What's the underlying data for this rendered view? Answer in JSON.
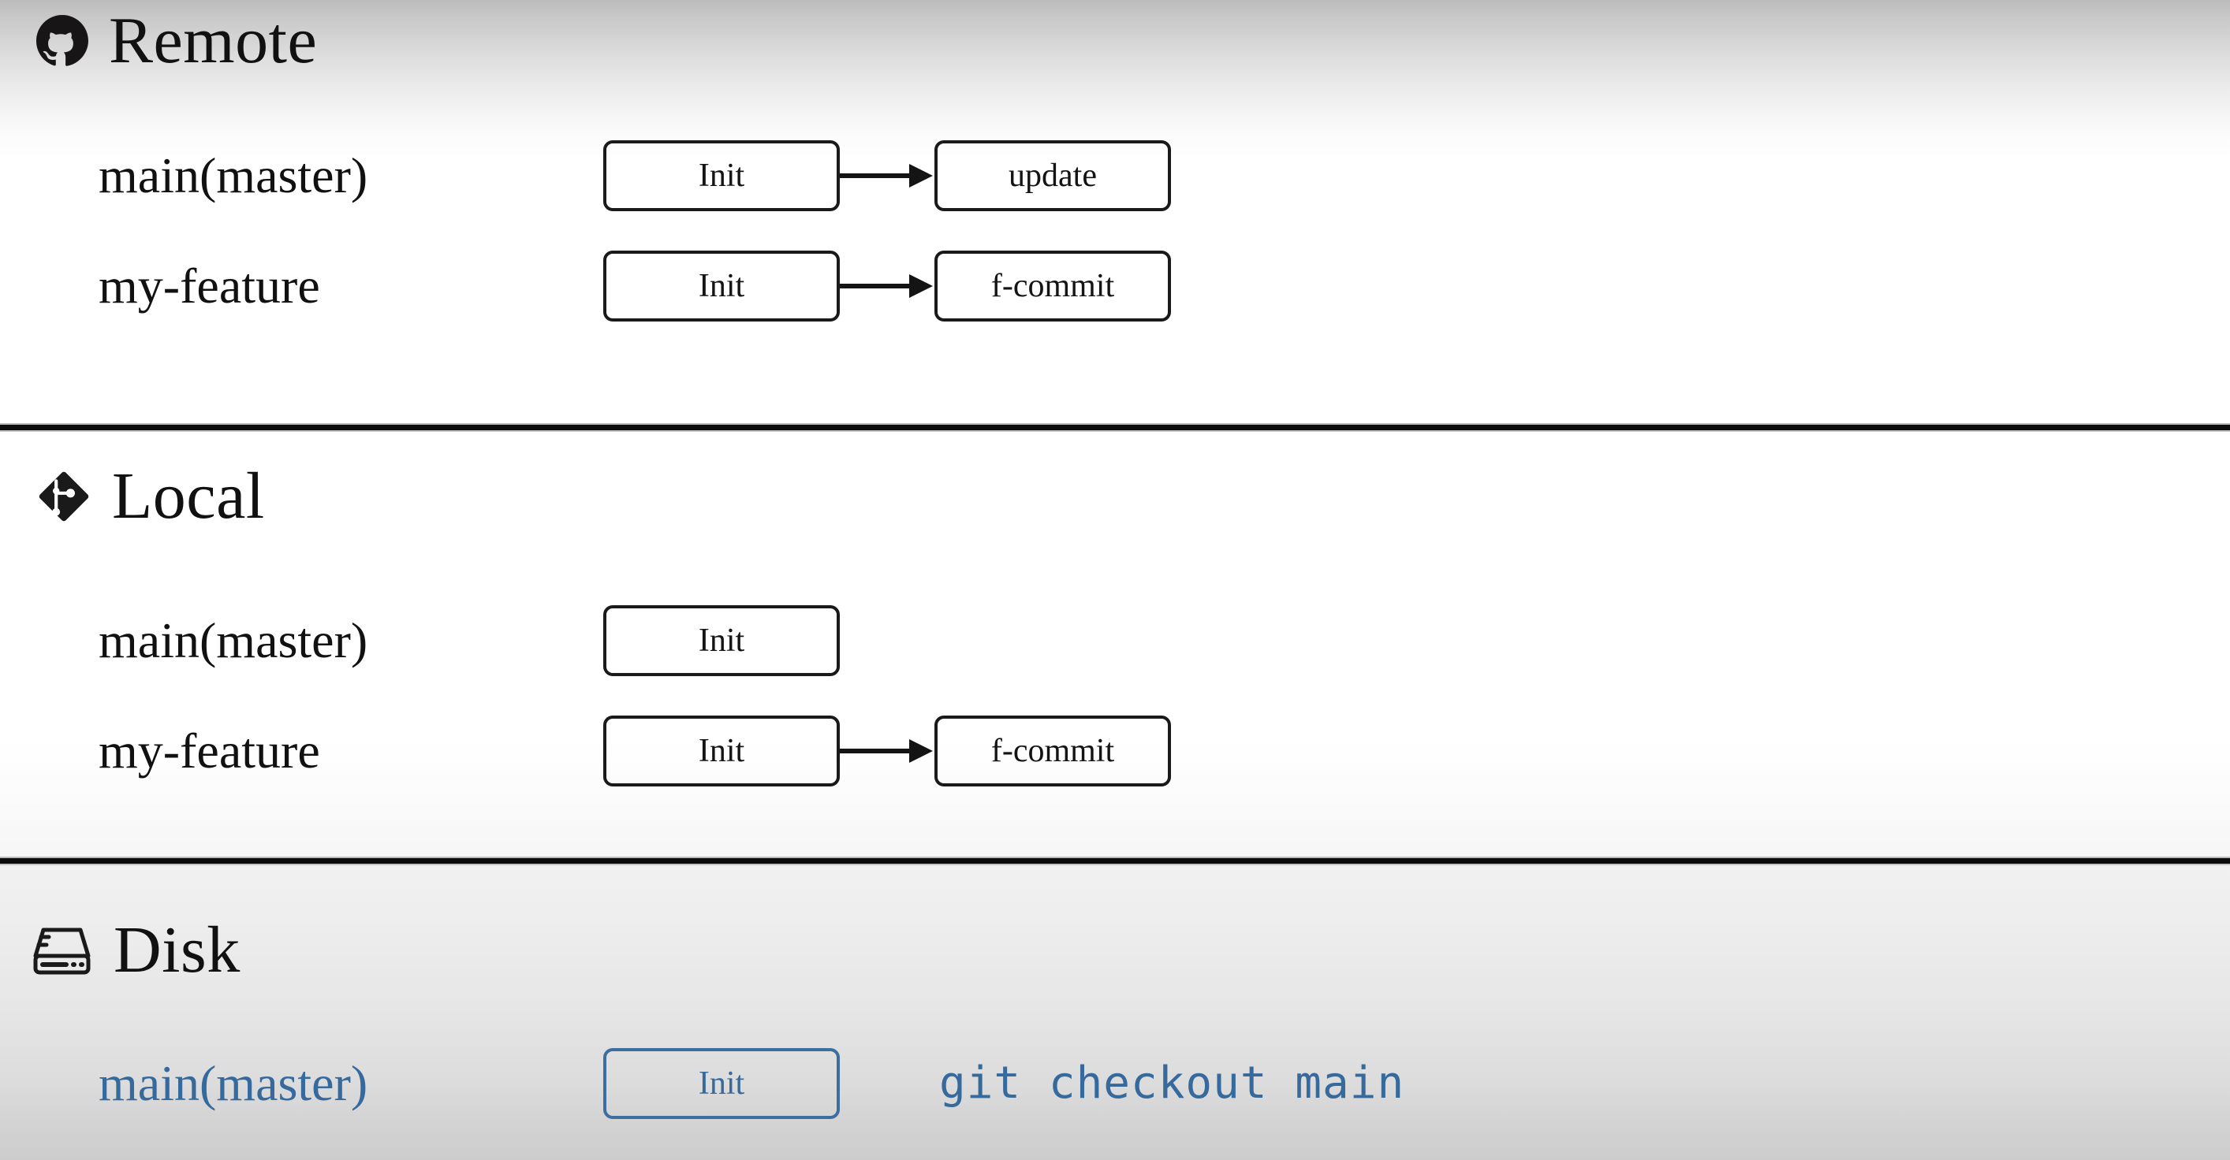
{
  "sections": [
    {
      "id": "remote",
      "title": "Remote",
      "icon": "github-octocat-icon",
      "rows": [
        {
          "label": "main(master)",
          "accent": false,
          "commits": [
            "Init",
            "update"
          ],
          "command": ""
        },
        {
          "label": "my-feature",
          "accent": false,
          "commits": [
            "Init",
            "f-commit"
          ],
          "command": ""
        }
      ]
    },
    {
      "id": "local",
      "title": "Local",
      "icon": "git-logo-icon",
      "rows": [
        {
          "label": "main(master)",
          "accent": false,
          "commits": [
            "Init"
          ],
          "command": ""
        },
        {
          "label": "my-feature",
          "accent": false,
          "commits": [
            "Init",
            "f-commit"
          ],
          "command": ""
        }
      ]
    },
    {
      "id": "disk",
      "title": "Disk",
      "icon": "hard-drive-icon",
      "rows": [
        {
          "label": "main(master)",
          "accent": true,
          "commits": [
            "Init"
          ],
          "command": "git checkout main"
        }
      ]
    }
  ],
  "colors": {
    "accent": "#36699c",
    "accent_border": "#3c6f9f",
    "ink": "#111111",
    "box_border": "#1a1a1a",
    "divider": "#0b0b0b",
    "bg_top_gray": "#bcbcbd",
    "bg_disk_gray": "#cdcdce"
  },
  "labels": {
    "remote_title": "Remote",
    "local_title": "Local",
    "disk_title": "Disk",
    "init": "Init",
    "update": "update",
    "f_commit": "f-commit",
    "main_master": "main(master)",
    "my_feature": "my-feature",
    "disk_command": "git checkout main"
  }
}
